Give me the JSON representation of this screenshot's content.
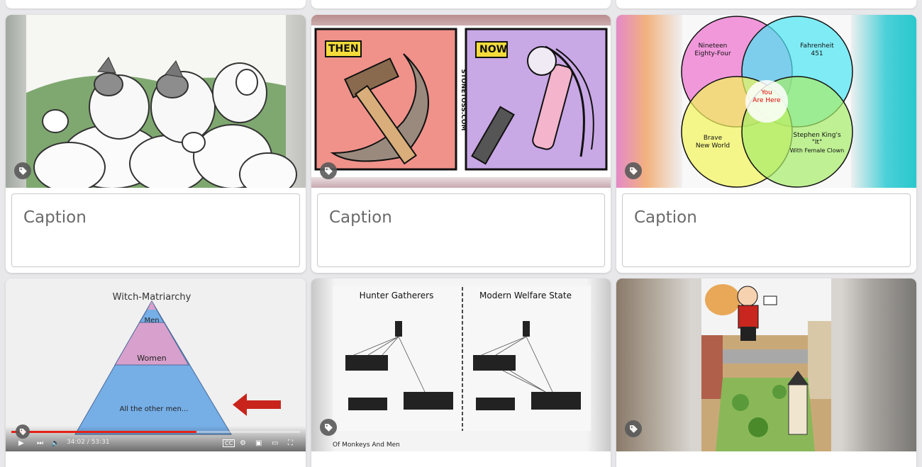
{
  "captions": {
    "placeholder": "Caption"
  },
  "card_hammer": {
    "then_label": "THEN",
    "now_label": "NOW",
    "site_credit": "STONETOSS.COM"
  },
  "card_venn": {
    "circle_1": [
      "Nineteen",
      "Eighty-Four"
    ],
    "circle_2": [
      "Fahrenheit",
      "451"
    ],
    "circle_3": [
      "Brave",
      "New World"
    ],
    "circle_4": [
      "Stephen King's",
      "\"It\"",
      "With Female Clown"
    ],
    "center": [
      "You",
      "Are Here"
    ]
  },
  "card_pyramid": {
    "title": "Witch-Matriarchy",
    "tiers": [
      "Men",
      "Women",
      "All the other men..."
    ],
    "video_time": "34:02 / 53:31",
    "progress_fraction": 0.642
  },
  "card_monkeys": {
    "left_title": "Hunter Gatherers",
    "right_title": "Modern Welfare State",
    "footer": "Of Monkeys And Men"
  },
  "icons": {
    "tag": "tag-icon",
    "play": "play-icon",
    "next": "next-icon",
    "volume": "volume-icon",
    "cc": "cc-icon",
    "settings": "gear-icon",
    "miniplayer": "miniplayer-icon",
    "theater": "theater-icon",
    "fullscreen": "fullscreen-icon"
  }
}
